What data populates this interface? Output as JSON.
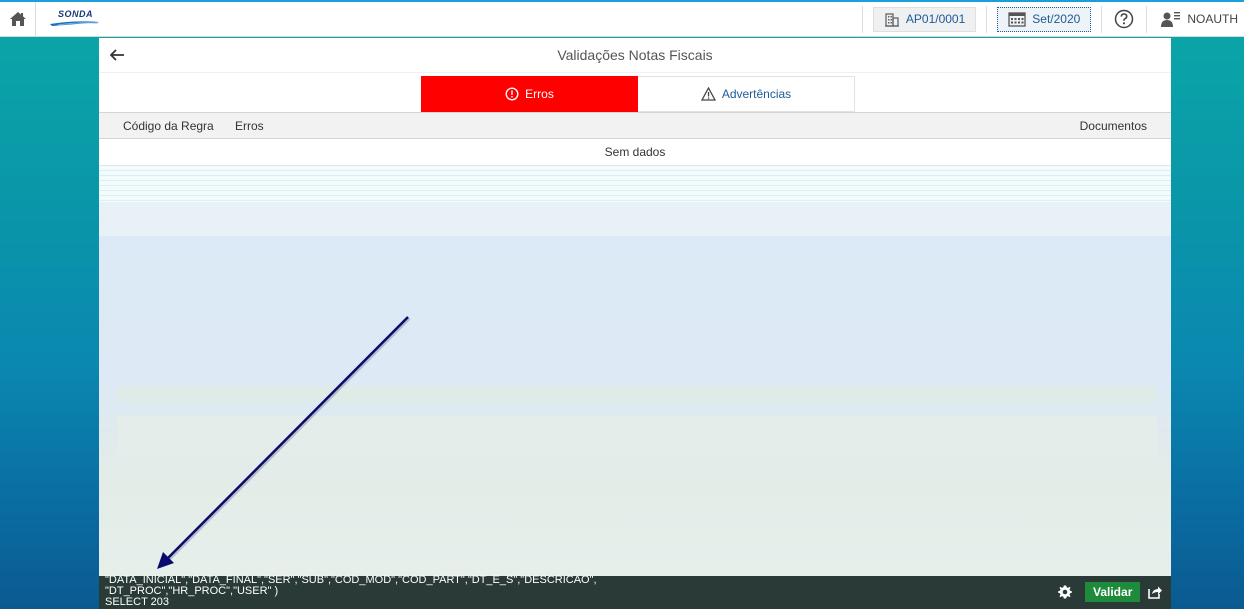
{
  "topbar": {
    "logo_text": "SONDA",
    "company": "AP01/0001",
    "period": "Set/2020",
    "user": "NOAUTH"
  },
  "page": {
    "title": "Validações Notas Fiscais"
  },
  "tabs": [
    {
      "label": "Erros",
      "active": true,
      "icon": "error-circle-icon"
    },
    {
      "label": "Advertências",
      "active": false,
      "icon": "warning-triangle-icon"
    }
  ],
  "table": {
    "columns": [
      "Código da Regra",
      "Erros",
      "Documentos"
    ],
    "empty_text": "Sem dados"
  },
  "footer": {
    "sql_line1": "\"DATA_INICIAL\",\"DATA_FINAL\",\"SER\",\"SUB\",\"COD_MOD\",\"COD_PART\",\"DT_E_S\",\"DESCRICAO\",",
    "sql_line2": "\"DT_PROC\",\"HR_PROC\",\"USER\" )",
    "sql_line3": "SELECT 203",
    "validar_label": "Validar"
  },
  "colors": {
    "accent_blue": "#1d5b96",
    "erros_tab": "#ff0000",
    "validar_green": "#1d8a3c",
    "annotation_arrow": "#0a0a6e"
  }
}
